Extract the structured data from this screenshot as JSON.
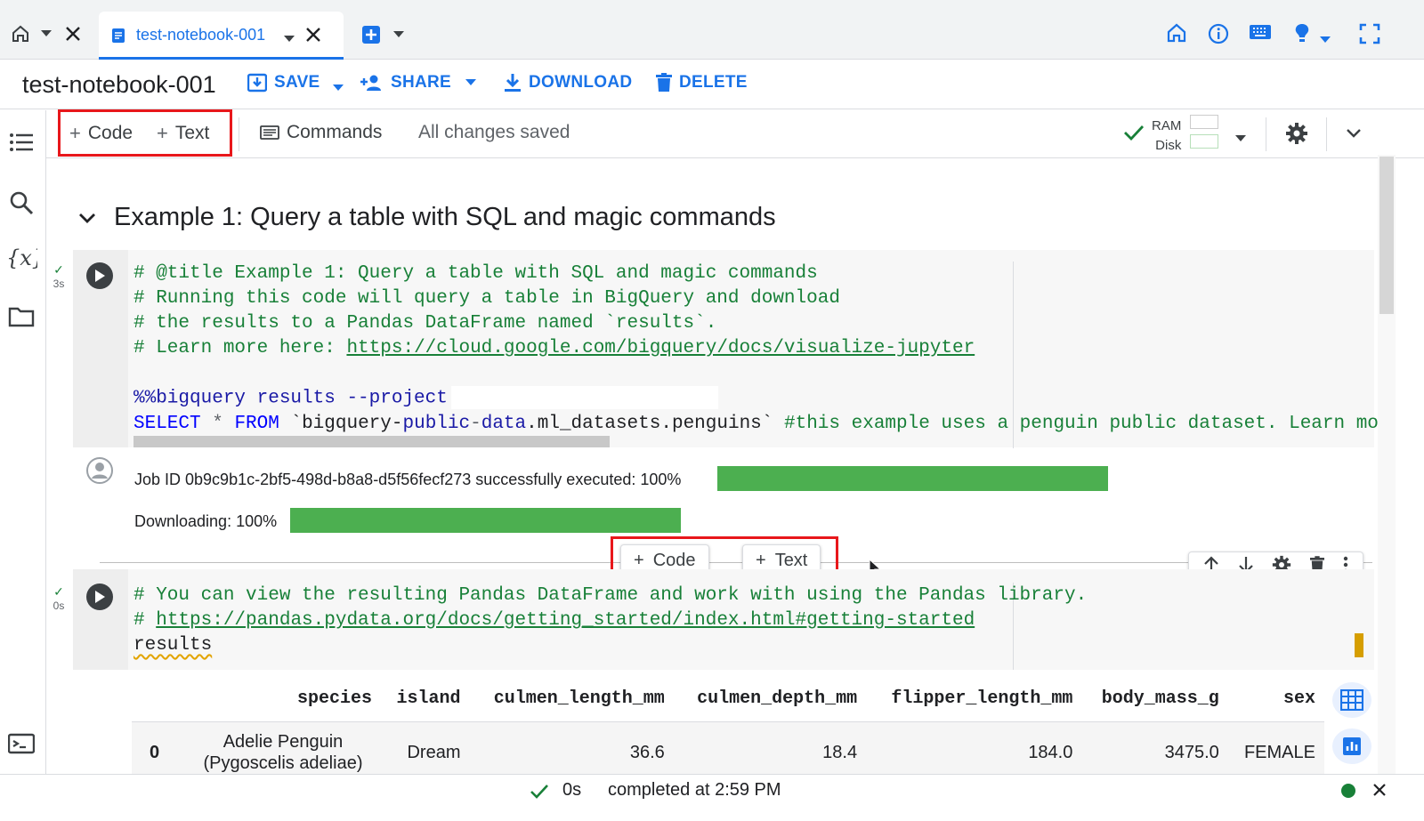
{
  "tabbar": {
    "tab_title": "test-notebook-001"
  },
  "titlebar": {
    "notebook_title": "test-notebook-001",
    "save_label": "SAVE",
    "share_label": "SHARE",
    "download_label": "DOWNLOAD",
    "delete_label": "DELETE"
  },
  "actionbar": {
    "add_code_label": "Code",
    "add_text_label": "Text",
    "commands_label": "Commands",
    "save_status": "All changes saved",
    "ram_label": "RAM",
    "disk_label": "Disk"
  },
  "section": {
    "title": "Example 1: Query a table with SQL and magic commands"
  },
  "cell1": {
    "exec_time": "3s",
    "line1": "# @title Example 1: Query a table with SQL and magic commands",
    "line2": "# Running this code will query a table in BigQuery and download",
    "line3": "# the results to a Pandas DataFrame named `results`.",
    "line4_prefix": "# Learn more here: ",
    "line4_link": "https://cloud.google.com/bigquery/docs/visualize-jupyter",
    "line6_magic": "%%bigquery results --project",
    "line7_kw1": "SELECT",
    "line7_star": " * ",
    "line7_kw2": "FROM",
    "line7_table_a": " `bigquery-",
    "line7_table_b": "public",
    "line7_table_c": "-",
    "line7_table_d": "data",
    "line7_table_e": ".ml_datasets.penguins` ",
    "line7_comment": "#this example uses a penguin public dataset. Learn mor"
  },
  "output1": {
    "job_text": "Job ID 0b9c9b1c-2bf5-498d-b8a8-d5f56fecf273 successfully executed: 100%",
    "job_progress": 1.0,
    "download_text": "Downloading: 100%",
    "download_progress": 1.0
  },
  "insert": {
    "code_label": "Code",
    "text_label": "Text"
  },
  "cell2": {
    "exec_time": "0s",
    "line1": "# You can view the resulting Pandas DataFrame and work with using the Pandas library.",
    "line2_prefix": "# ",
    "line2_link": "https://pandas.pydata.org/docs/getting_started/index.html#getting-started",
    "line3": "results"
  },
  "table": {
    "columns": [
      "",
      "species",
      "island",
      "culmen_length_mm",
      "culmen_depth_mm",
      "flipper_length_mm",
      "body_mass_g",
      "sex"
    ],
    "row0": {
      "index": "0",
      "species_line1": "Adelie Penguin",
      "species_line2": "(Pygoscelis adeliae)",
      "island": "Dream",
      "culmen_length_mm": "36.6",
      "culmen_depth_mm": "18.4",
      "flipper_length_mm": "184.0",
      "body_mass_g": "3475.0",
      "sex": "FEMALE"
    }
  },
  "statusbar": {
    "duration": "0s",
    "completed_text": "completed at 2:59 PM"
  },
  "colors": {
    "accent": "#1a73e8",
    "highlight": "#e8171b",
    "progress": "#4caf50",
    "code_comment": "#188038",
    "keyword": "#0000ff"
  }
}
